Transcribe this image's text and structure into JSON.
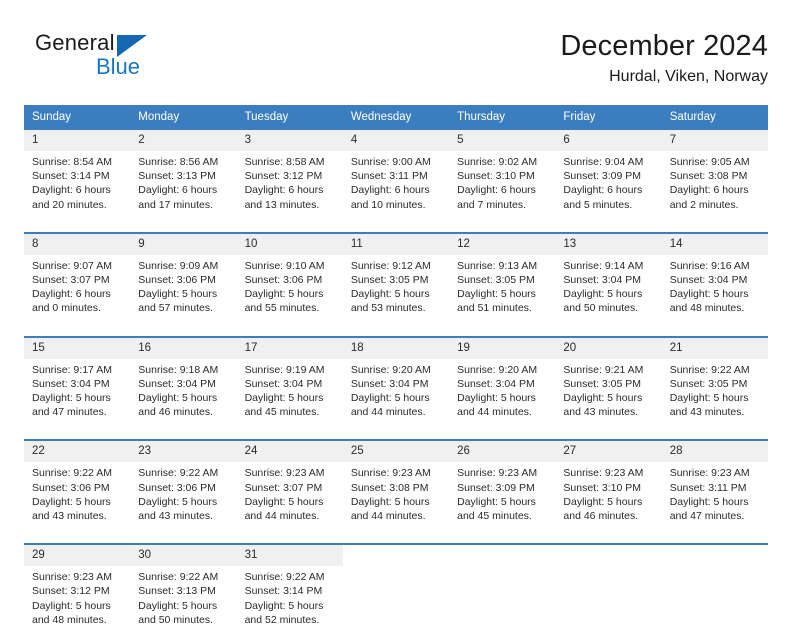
{
  "brand": {
    "name_top": "General",
    "name_bottom": "Blue",
    "triangle_icon": "brand-triangle-icon",
    "colors": {
      "blue": "#1878c8",
      "triangle": "#1567b2",
      "dark": "#1b1b1b"
    }
  },
  "header": {
    "title": "December 2024",
    "subtitle": "Hurdal, Viken, Norway"
  },
  "theme": {
    "header_bg": "#3b7ebf",
    "header_text": "#ffffff",
    "day_band_bg": "#f0f0f0",
    "body_text": "#2b2b2b"
  },
  "weekdays": [
    "Sunday",
    "Monday",
    "Tuesday",
    "Wednesday",
    "Thursday",
    "Friday",
    "Saturday"
  ],
  "weeks": [
    [
      {
        "day": "1",
        "sunrise": "Sunrise: 8:54 AM",
        "sunset": "Sunset: 3:14 PM",
        "daylight_1": "Daylight: 6 hours",
        "daylight_2": "and 20 minutes."
      },
      {
        "day": "2",
        "sunrise": "Sunrise: 8:56 AM",
        "sunset": "Sunset: 3:13 PM",
        "daylight_1": "Daylight: 6 hours",
        "daylight_2": "and 17 minutes."
      },
      {
        "day": "3",
        "sunrise": "Sunrise: 8:58 AM",
        "sunset": "Sunset: 3:12 PM",
        "daylight_1": "Daylight: 6 hours",
        "daylight_2": "and 13 minutes."
      },
      {
        "day": "4",
        "sunrise": "Sunrise: 9:00 AM",
        "sunset": "Sunset: 3:11 PM",
        "daylight_1": "Daylight: 6 hours",
        "daylight_2": "and 10 minutes."
      },
      {
        "day": "5",
        "sunrise": "Sunrise: 9:02 AM",
        "sunset": "Sunset: 3:10 PM",
        "daylight_1": "Daylight: 6 hours",
        "daylight_2": "and 7 minutes."
      },
      {
        "day": "6",
        "sunrise": "Sunrise: 9:04 AM",
        "sunset": "Sunset: 3:09 PM",
        "daylight_1": "Daylight: 6 hours",
        "daylight_2": "and 5 minutes."
      },
      {
        "day": "7",
        "sunrise": "Sunrise: 9:05 AM",
        "sunset": "Sunset: 3:08 PM",
        "daylight_1": "Daylight: 6 hours",
        "daylight_2": "and 2 minutes."
      }
    ],
    [
      {
        "day": "8",
        "sunrise": "Sunrise: 9:07 AM",
        "sunset": "Sunset: 3:07 PM",
        "daylight_1": "Daylight: 6 hours",
        "daylight_2": "and 0 minutes."
      },
      {
        "day": "9",
        "sunrise": "Sunrise: 9:09 AM",
        "sunset": "Sunset: 3:06 PM",
        "daylight_1": "Daylight: 5 hours",
        "daylight_2": "and 57 minutes."
      },
      {
        "day": "10",
        "sunrise": "Sunrise: 9:10 AM",
        "sunset": "Sunset: 3:06 PM",
        "daylight_1": "Daylight: 5 hours",
        "daylight_2": "and 55 minutes."
      },
      {
        "day": "11",
        "sunrise": "Sunrise: 9:12 AM",
        "sunset": "Sunset: 3:05 PM",
        "daylight_1": "Daylight: 5 hours",
        "daylight_2": "and 53 minutes."
      },
      {
        "day": "12",
        "sunrise": "Sunrise: 9:13 AM",
        "sunset": "Sunset: 3:05 PM",
        "daylight_1": "Daylight: 5 hours",
        "daylight_2": "and 51 minutes."
      },
      {
        "day": "13",
        "sunrise": "Sunrise: 9:14 AM",
        "sunset": "Sunset: 3:04 PM",
        "daylight_1": "Daylight: 5 hours",
        "daylight_2": "and 50 minutes."
      },
      {
        "day": "14",
        "sunrise": "Sunrise: 9:16 AM",
        "sunset": "Sunset: 3:04 PM",
        "daylight_1": "Daylight: 5 hours",
        "daylight_2": "and 48 minutes."
      }
    ],
    [
      {
        "day": "15",
        "sunrise": "Sunrise: 9:17 AM",
        "sunset": "Sunset: 3:04 PM",
        "daylight_1": "Daylight: 5 hours",
        "daylight_2": "and 47 minutes."
      },
      {
        "day": "16",
        "sunrise": "Sunrise: 9:18 AM",
        "sunset": "Sunset: 3:04 PM",
        "daylight_1": "Daylight: 5 hours",
        "daylight_2": "and 46 minutes."
      },
      {
        "day": "17",
        "sunrise": "Sunrise: 9:19 AM",
        "sunset": "Sunset: 3:04 PM",
        "daylight_1": "Daylight: 5 hours",
        "daylight_2": "and 45 minutes."
      },
      {
        "day": "18",
        "sunrise": "Sunrise: 9:20 AM",
        "sunset": "Sunset: 3:04 PM",
        "daylight_1": "Daylight: 5 hours",
        "daylight_2": "and 44 minutes."
      },
      {
        "day": "19",
        "sunrise": "Sunrise: 9:20 AM",
        "sunset": "Sunset: 3:04 PM",
        "daylight_1": "Daylight: 5 hours",
        "daylight_2": "and 44 minutes."
      },
      {
        "day": "20",
        "sunrise": "Sunrise: 9:21 AM",
        "sunset": "Sunset: 3:05 PM",
        "daylight_1": "Daylight: 5 hours",
        "daylight_2": "and 43 minutes."
      },
      {
        "day": "21",
        "sunrise": "Sunrise: 9:22 AM",
        "sunset": "Sunset: 3:05 PM",
        "daylight_1": "Daylight: 5 hours",
        "daylight_2": "and 43 minutes."
      }
    ],
    [
      {
        "day": "22",
        "sunrise": "Sunrise: 9:22 AM",
        "sunset": "Sunset: 3:06 PM",
        "daylight_1": "Daylight: 5 hours",
        "daylight_2": "and 43 minutes."
      },
      {
        "day": "23",
        "sunrise": "Sunrise: 9:22 AM",
        "sunset": "Sunset: 3:06 PM",
        "daylight_1": "Daylight: 5 hours",
        "daylight_2": "and 43 minutes."
      },
      {
        "day": "24",
        "sunrise": "Sunrise: 9:23 AM",
        "sunset": "Sunset: 3:07 PM",
        "daylight_1": "Daylight: 5 hours",
        "daylight_2": "and 44 minutes."
      },
      {
        "day": "25",
        "sunrise": "Sunrise: 9:23 AM",
        "sunset": "Sunset: 3:08 PM",
        "daylight_1": "Daylight: 5 hours",
        "daylight_2": "and 44 minutes."
      },
      {
        "day": "26",
        "sunrise": "Sunrise: 9:23 AM",
        "sunset": "Sunset: 3:09 PM",
        "daylight_1": "Daylight: 5 hours",
        "daylight_2": "and 45 minutes."
      },
      {
        "day": "27",
        "sunrise": "Sunrise: 9:23 AM",
        "sunset": "Sunset: 3:10 PM",
        "daylight_1": "Daylight: 5 hours",
        "daylight_2": "and 46 minutes."
      },
      {
        "day": "28",
        "sunrise": "Sunrise: 9:23 AM",
        "sunset": "Sunset: 3:11 PM",
        "daylight_1": "Daylight: 5 hours",
        "daylight_2": "and 47 minutes."
      }
    ],
    [
      {
        "day": "29",
        "sunrise": "Sunrise: 9:23 AM",
        "sunset": "Sunset: 3:12 PM",
        "daylight_1": "Daylight: 5 hours",
        "daylight_2": "and 48 minutes."
      },
      {
        "day": "30",
        "sunrise": "Sunrise: 9:22 AM",
        "sunset": "Sunset: 3:13 PM",
        "daylight_1": "Daylight: 5 hours",
        "daylight_2": "and 50 minutes."
      },
      {
        "day": "31",
        "sunrise": "Sunrise: 9:22 AM",
        "sunset": "Sunset: 3:14 PM",
        "daylight_1": "Daylight: 5 hours",
        "daylight_2": "and 52 minutes."
      },
      {
        "day": "",
        "sunrise": "",
        "sunset": "",
        "daylight_1": "",
        "daylight_2": ""
      },
      {
        "day": "",
        "sunrise": "",
        "sunset": "",
        "daylight_1": "",
        "daylight_2": ""
      },
      {
        "day": "",
        "sunrise": "",
        "sunset": "",
        "daylight_1": "",
        "daylight_2": ""
      },
      {
        "day": "",
        "sunrise": "",
        "sunset": "",
        "daylight_1": "",
        "daylight_2": ""
      }
    ]
  ]
}
